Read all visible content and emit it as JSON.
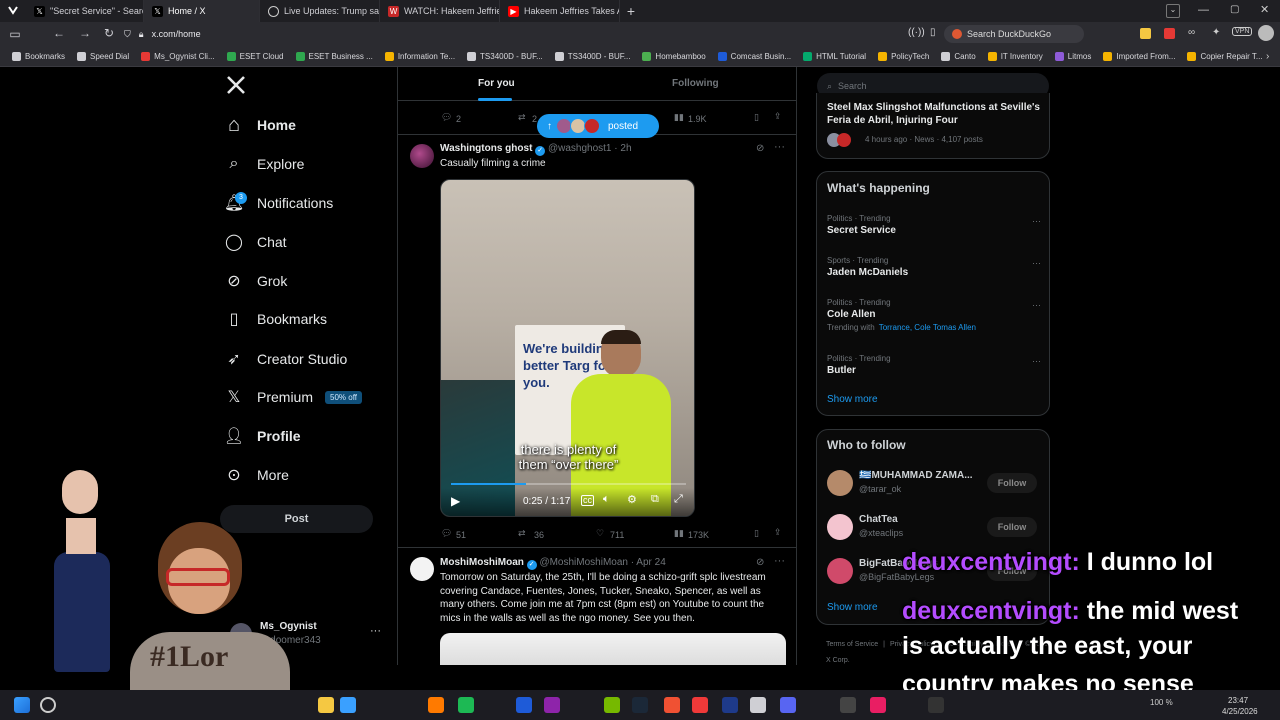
{
  "browser": {
    "tabs": [
      {
        "label": "\"Secret Service\" - Search / X",
        "icon": "x-logo-icon",
        "active": false
      },
      {
        "label": "Home / X",
        "icon": "x-logo-icon",
        "active": true
      },
      {
        "label": "Live Updates: Trump safe at",
        "icon": "globe-icon",
        "active": false
      },
      {
        "label": "WATCH: Hakeem Jeffries Vo",
        "icon": "news-icon",
        "active": false
      },
      {
        "label": "Hakeem Jeffries Takes Aim",
        "icon": "youtube-icon",
        "active": false
      }
    ],
    "new_tab": "+",
    "url": "x.com/home",
    "search_placeholder": "Search DuckDuckGo",
    "vpn_badge": "VPN"
  },
  "bookmarks": [
    {
      "label": "Bookmarks",
      "color": "#cfcfd4"
    },
    {
      "label": "Speed Dial",
      "color": "#cfcfd4"
    },
    {
      "label": "Ms_Ogynist Cli...",
      "color": "#e53935"
    },
    {
      "label": "ESET Cloud",
      "color": "#2fa84f"
    },
    {
      "label": "ESET Business ...",
      "color": "#2fa84f"
    },
    {
      "label": "Information Te...",
      "color": "#f5b400"
    },
    {
      "label": "TS3400D - BUF...",
      "color": "#cfcfd4"
    },
    {
      "label": "TS3400D - BUF...",
      "color": "#cfcfd4"
    },
    {
      "label": "Homebamboo",
      "color": "#4caf50"
    },
    {
      "label": "Comcast Busin...",
      "color": "#1e5bd8"
    },
    {
      "label": "HTML Tutorial",
      "color": "#04aa6d"
    },
    {
      "label": "PolicyTech",
      "color": "#f5b400"
    },
    {
      "label": "Canto",
      "color": "#cfcfd4"
    },
    {
      "label": "IT Inventory",
      "color": "#f5b400"
    },
    {
      "label": "Litmos",
      "color": "#8e5bd8"
    },
    {
      "label": "Imported From...",
      "color": "#f5b400"
    },
    {
      "label": "Copier Repair T...",
      "color": "#f5b400"
    }
  ],
  "sidebar": {
    "items": [
      {
        "label": "Home",
        "icon": "home-icon"
      },
      {
        "label": "Explore",
        "icon": "search-icon"
      },
      {
        "label": "Notifications",
        "icon": "bell-icon",
        "badge": "3"
      },
      {
        "label": "Chat",
        "icon": "chat-icon"
      },
      {
        "label": "Grok",
        "icon": "grok-icon"
      },
      {
        "label": "Bookmarks",
        "icon": "bookmark-icon"
      },
      {
        "label": "Creator Studio",
        "icon": "rocket-icon"
      },
      {
        "label": "Premium",
        "icon": "x-logo-icon",
        "badge": "50% off"
      },
      {
        "label": "Profile",
        "icon": "person-icon"
      },
      {
        "label": "More",
        "icon": "more-circle-icon"
      }
    ],
    "post_button": "Post",
    "account": {
      "name": "Ms_Ogynist",
      "handle": "@doomer343",
      "more": "···"
    }
  },
  "feed": {
    "tabs": [
      "For you",
      "Following"
    ],
    "posted_pill": "posted",
    "top_stats": {
      "replies": "2",
      "reposts": "2",
      "views": "1.9K"
    },
    "post1": {
      "author": "Washingtons ghost",
      "handle": "@washghost1",
      "time": "· 2h",
      "text": "Casually filming a crime",
      "video_sign": "We're building a better Targ for you.",
      "caption_line1": "there is plenty of",
      "caption_line2": "them “over there”",
      "video_time": "0:25 / 1:17",
      "stats": {
        "replies": "51",
        "reposts": "36",
        "likes": "711",
        "views": "173K"
      }
    },
    "post2": {
      "author": "MoshiMoshiMoan",
      "handle": "@MoshiMoshiMoan",
      "time": "· Apr 24",
      "text": "Tomorrow on Saturday, the 25th, I'll be doing a schizo-grift splc livestream covering Candace, Fuentes, Jones, Tucker, Sneako, Spencer, as well as many others.  Come join me at 7pm cst (8pm est) on Youtube to count the mics in the walls as well as the ngo money.  See you then."
    }
  },
  "right": {
    "search_placeholder": "Search",
    "news": {
      "title": "Steel Max Slingshot Malfunctions at Seville's Feria de Abril, Injuring Four",
      "meta": "4 hours ago · News · 4,107 posts"
    },
    "whats_happening": {
      "title": "What's happening",
      "trends": [
        {
          "meta": "Politics · Trending",
          "name": "Secret Service",
          "extra": ""
        },
        {
          "meta": "Sports · Trending",
          "name": "Jaden McDaniels",
          "extra": ""
        },
        {
          "meta": "Politics · Trending",
          "name": "Cole Allen",
          "extra_prefix": "Trending with",
          "extra": "Torrance, Cole Tomas Allen"
        },
        {
          "meta": "Politics · Trending",
          "name": "Butler",
          "extra": ""
        }
      ],
      "show_more": "Show more"
    },
    "who_to_follow": {
      "title": "Who to follow",
      "users": [
        {
          "name": "MUHAMMAD ZAMA...",
          "handle": "@tarar_ok",
          "button": "Follow",
          "flag": "🇬🇷"
        },
        {
          "name": "ChatTea",
          "handle": "@xteaclips",
          "button": "Follow"
        },
        {
          "name": "BigFatBabyLegs",
          "handle": "@BigFatBabyLegs",
          "button": "Follow"
        }
      ],
      "show_more": "Show more"
    },
    "footer": [
      "Terms of Service",
      "|",
      "Privacy Policy",
      "|",
      "Accessibility",
      "|",
      "More ···",
      "© 2026 X Corp."
    ]
  },
  "chat_overlay": [
    {
      "user": "deuxcentvingt:",
      "message": "I dunno lol"
    },
    {
      "user": "deuxcentvingt:",
      "message": "the mid west"
    },
    {
      "user": "",
      "message": "is actually the east, your"
    },
    {
      "user": "",
      "message": "country makes no sense"
    }
  ],
  "taskbar": {
    "time": "23:47",
    "date": "4/25/2026",
    "zoom": "100 %"
  },
  "colors": {
    "accent": "#1d9bf0",
    "chat_user": "#b44cff",
    "bg": "#000000",
    "border": "#2f3336"
  }
}
